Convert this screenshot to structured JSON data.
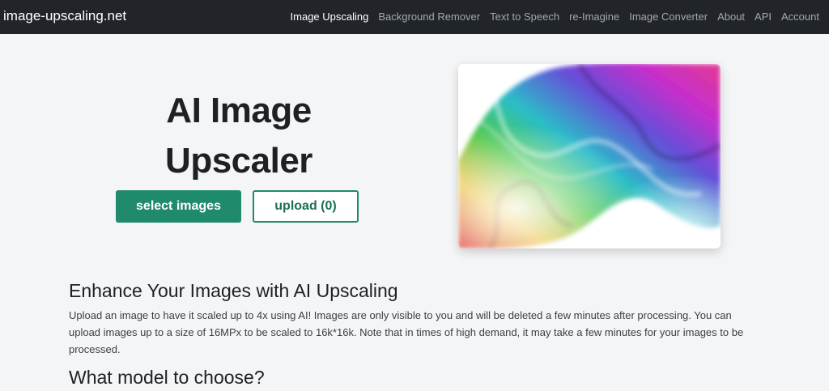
{
  "nav": {
    "brand": "image-upscaling.net",
    "links": [
      "Image Upscaling",
      "Background Remover",
      "Text to Speech",
      "re-Imagine",
      "Image Converter",
      "About",
      "API",
      "Account"
    ],
    "active_index": 0
  },
  "hero": {
    "title": "AI Image Upscaler",
    "select_button": "select images",
    "upload_button": "upload (0)",
    "image_description_icon": "colorful-smoke-image"
  },
  "content": {
    "heading": "Enhance Your Images with AI Upscaling",
    "description": "Upload an image to have it scaled up to 4x using AI! Images are only visible to you and will be deleted a few minutes after processing. You can upload images up to a size of 16MPx to be scaled to 16k*16k. Note that in times of high demand, it may take a few minutes for your images to be processed.",
    "subheading": "What model to choose?"
  },
  "colors": {
    "navbar": "#212529",
    "accent": "#208a6c",
    "background": "#f4f5f6"
  }
}
